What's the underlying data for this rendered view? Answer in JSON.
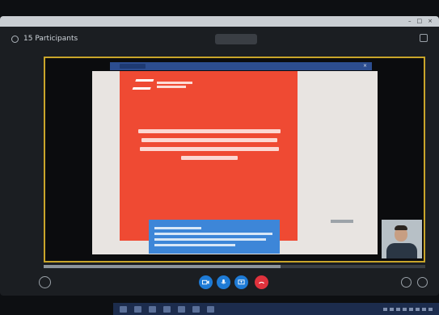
{
  "app": {
    "title": ""
  },
  "topbar": {
    "participants_label": "15 Participants",
    "meeting_pill": "",
    "right_label": ""
  },
  "share_bar": {
    "label": "",
    "close_icon": "×"
  },
  "slide": {
    "title": "",
    "presenter_name": ""
  },
  "controls": {
    "buttons": [
      {
        "icon": "video-icon",
        "color": "#1e7bd6"
      },
      {
        "icon": "microphone-icon",
        "color": "#1e7bd6"
      },
      {
        "icon": "share-screen-icon",
        "color": "#1e7bd6"
      },
      {
        "icon": "end-call-icon",
        "color": "#e0323d"
      }
    ]
  },
  "colors": {
    "accent": "#1e7bd6",
    "end_call": "#e0323d",
    "slide_red": "#ef4a33",
    "presenter_box": "#3d86d8",
    "active_speaker_border": "#c9a52a"
  },
  "progress": {
    "value": 0.62
  }
}
